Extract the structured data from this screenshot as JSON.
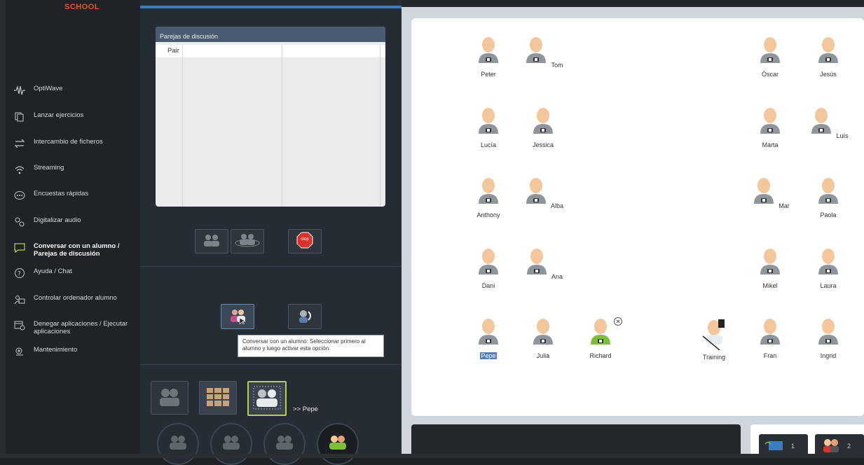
{
  "sidebar": {
    "logo": "SCHOOL",
    "items": [
      {
        "icon": "waveform-icon",
        "label": "OptiWave"
      },
      {
        "icon": "copy-icon",
        "label": "Lanzar ejercicios"
      },
      {
        "icon": "transfer-arrows-icon",
        "label": "Intercambio de ficheros"
      },
      {
        "icon": "wifi-icon",
        "label": "Streaming"
      },
      {
        "icon": "poll-icon",
        "label": "Encuestas rápidas"
      },
      {
        "icon": "record-audio-icon",
        "label": "Digitalizar audio"
      },
      {
        "icon": "chat-bubble-icon",
        "label": "Conversar con un alumno /",
        "label2": "Parejas de discusión",
        "active": true
      },
      {
        "icon": "help-icon",
        "label": "Ayuda / Chat"
      },
      {
        "icon": "remote-control-icon",
        "label": "Controlar ordenador alumno"
      },
      {
        "icon": "deny-apps-icon",
        "label": "Denegar aplicaciones / Ejecutar",
        "label2": "aplicaciones"
      },
      {
        "icon": "maintenance-icon",
        "label": "Mantenimiento"
      }
    ]
  },
  "pairs": {
    "title": "Parejas de discusión",
    "column": "Pair"
  },
  "controls": {
    "stop_label": "stop",
    "tooltip": "Conversar con un alumno: Seleccionar primero al alumno y luego activar esta opción.",
    "selected_target": ">> Pepe"
  },
  "students": [
    {
      "name": "Peter"
    },
    {
      "name": "Tom"
    },
    {
      "name": "Óscar"
    },
    {
      "name": "Jesús"
    },
    {
      "name": "Lucía"
    },
    {
      "name": "Jessica"
    },
    {
      "name": "Marta"
    },
    {
      "name": "Luís"
    },
    {
      "name": "Anthony"
    },
    {
      "name": "Alba"
    },
    {
      "name": "Mar"
    },
    {
      "name": "Paola"
    },
    {
      "name": "Dani"
    },
    {
      "name": "Ana"
    },
    {
      "name": "Mikel"
    },
    {
      "name": "Laura"
    },
    {
      "name": "Pepe",
      "selected": true
    },
    {
      "name": "Julia"
    },
    {
      "name": "Richard",
      "active": true
    },
    {
      "name": "Training",
      "teacher": true
    },
    {
      "name": "Fran"
    },
    {
      "name": "Ingrid"
    }
  ],
  "bottom": {
    "btn1_count": "1",
    "btn2_count": "2"
  },
  "colors": {
    "accent": "#3b7bc4",
    "logo": "#e0591c",
    "stop": "#d9322b",
    "highlight_border": "#b5d33b",
    "active_student": "#7bbf3a"
  }
}
